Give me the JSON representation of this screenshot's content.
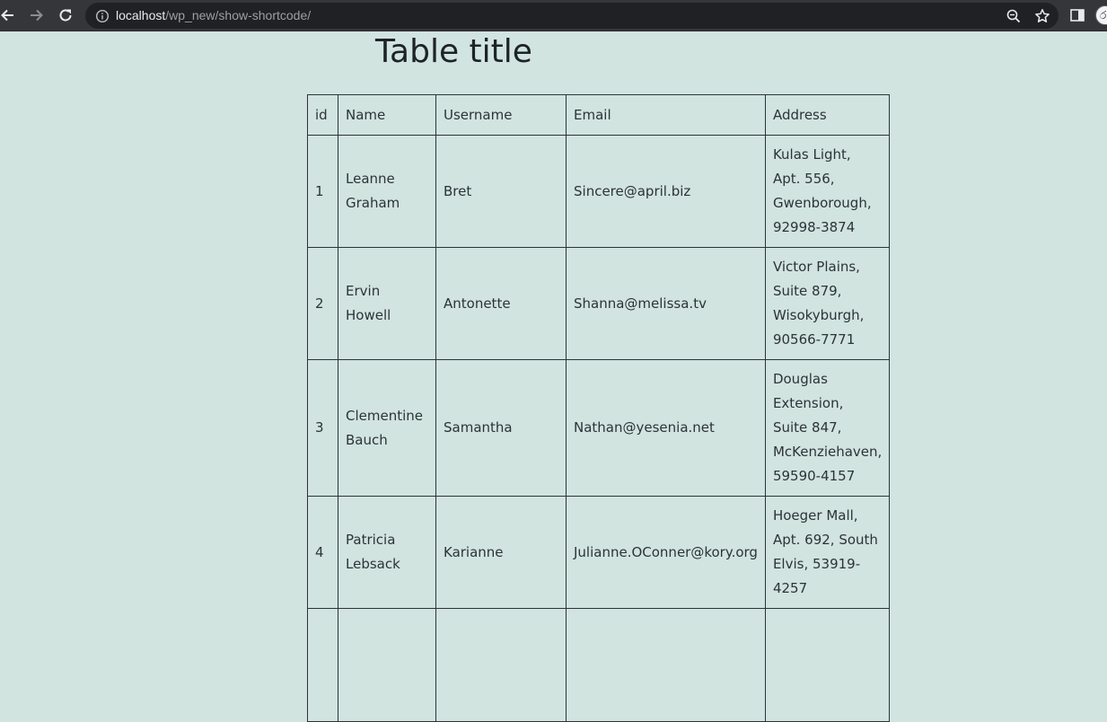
{
  "browser": {
    "url_host": "localhost",
    "url_path": "/wp_new/show-shortcode/",
    "profile_initial": "ර"
  },
  "page": {
    "title": "Table title"
  },
  "table": {
    "headers": [
      "id",
      "Name",
      "Username",
      "Email",
      "Address"
    ],
    "rows": [
      {
        "id": "1",
        "name": "Leanne Graham",
        "username": "Bret",
        "email": "Sincere@april.biz",
        "address": "Kulas Light, Apt. 556, Gwenborough, 92998-3874"
      },
      {
        "id": "2",
        "name": "Ervin Howell",
        "username": "Antonette",
        "email": "Shanna@melissa.tv",
        "address": "Victor Plains, Suite 879, Wisokyburgh, 90566-7771"
      },
      {
        "id": "3",
        "name": "Clementine Bauch",
        "username": "Samantha",
        "email": "Nathan@yesenia.net",
        "address": "Douglas Extension, Suite 847, McKenziehaven, 59590-4157"
      },
      {
        "id": "4",
        "name": "Patricia Lebsack",
        "username": "Karianne",
        "email": "Julianne.OConner@kory.org",
        "address": "Hoeger Mall, Apt. 692, South Elvis, 53919-4257"
      },
      {
        "id": "",
        "name": "",
        "username": "",
        "email": "",
        "address": ""
      }
    ]
  },
  "icons": {
    "back": "arrow-left-icon",
    "forward": "arrow-right-icon",
    "reload": "reload-icon",
    "info": "info-icon",
    "zoom": "zoom-icon",
    "bookmark": "star-icon",
    "side_panel": "side-panel-icon"
  },
  "colors": {
    "page_background": "#d1e4df",
    "table_border": "#2c3338",
    "toolbar": "#35363a",
    "omnibox": "#202124"
  }
}
